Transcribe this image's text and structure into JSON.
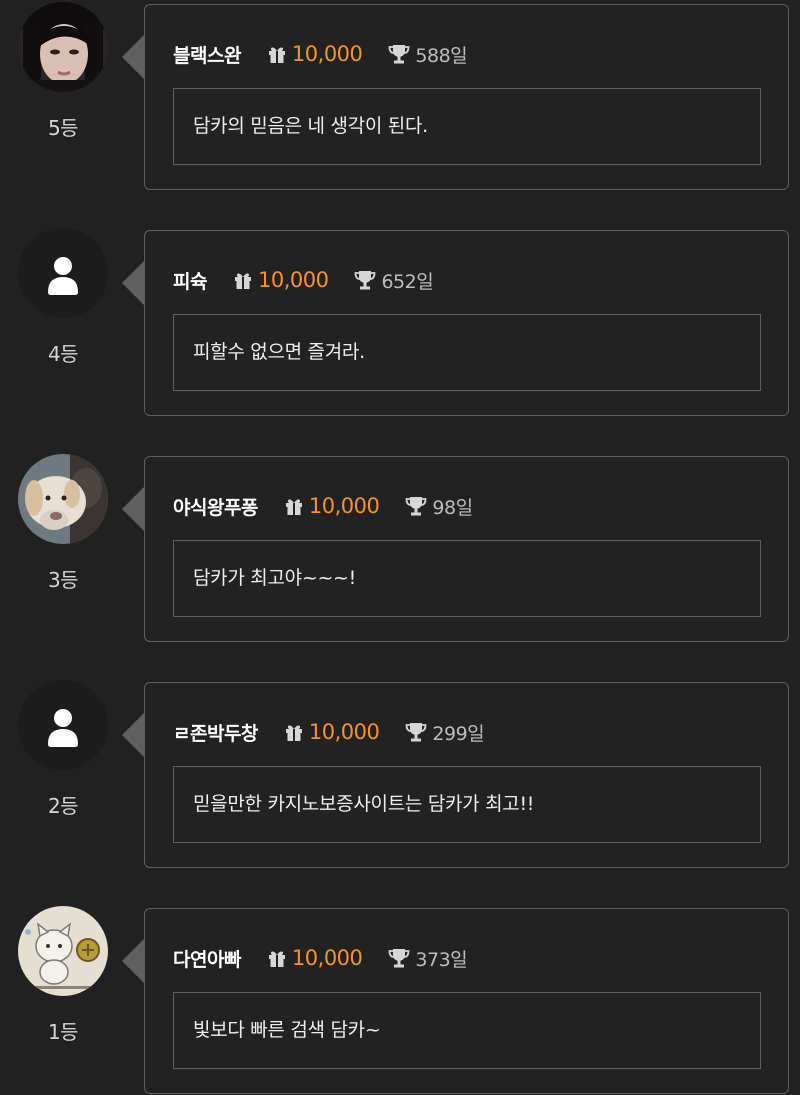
{
  "comments": [
    {
      "nickname": "블랙스완",
      "points": "10,000",
      "days": "588일",
      "message": "담카의 믿음은 네 생각이 된다.",
      "rank": "5등",
      "avatar": "photo-woman-icon"
    },
    {
      "nickname": "피슉",
      "points": "10,000",
      "days": "652일",
      "message": "피할수 없으면 즐겨라.",
      "rank": "4등",
      "avatar": "default-user-icon"
    },
    {
      "nickname": "야식왕푸퐁",
      "points": "10,000",
      "days": "98일",
      "message": "담카가 최고야~~~!",
      "rank": "3등",
      "avatar": "photo-dog-icon"
    },
    {
      "nickname": "ㄹ존박두창",
      "points": "10,000",
      "days": "299일",
      "message": "믿을만한 카지노보증사이트는 담카가 최고!!",
      "rank": "2등",
      "avatar": "default-user-icon"
    },
    {
      "nickname": "다연아빠",
      "points": "10,000",
      "days": "373일",
      "message": "빛보다 빠른 검색 담카~",
      "rank": "1등",
      "avatar": "drawing-cat-icon"
    }
  ],
  "colors": {
    "background": "#212121",
    "border": "#5f5f5f",
    "points": "#f7932e"
  },
  "icons": {
    "points": "gift-icon",
    "days": "trophy-icon"
  }
}
